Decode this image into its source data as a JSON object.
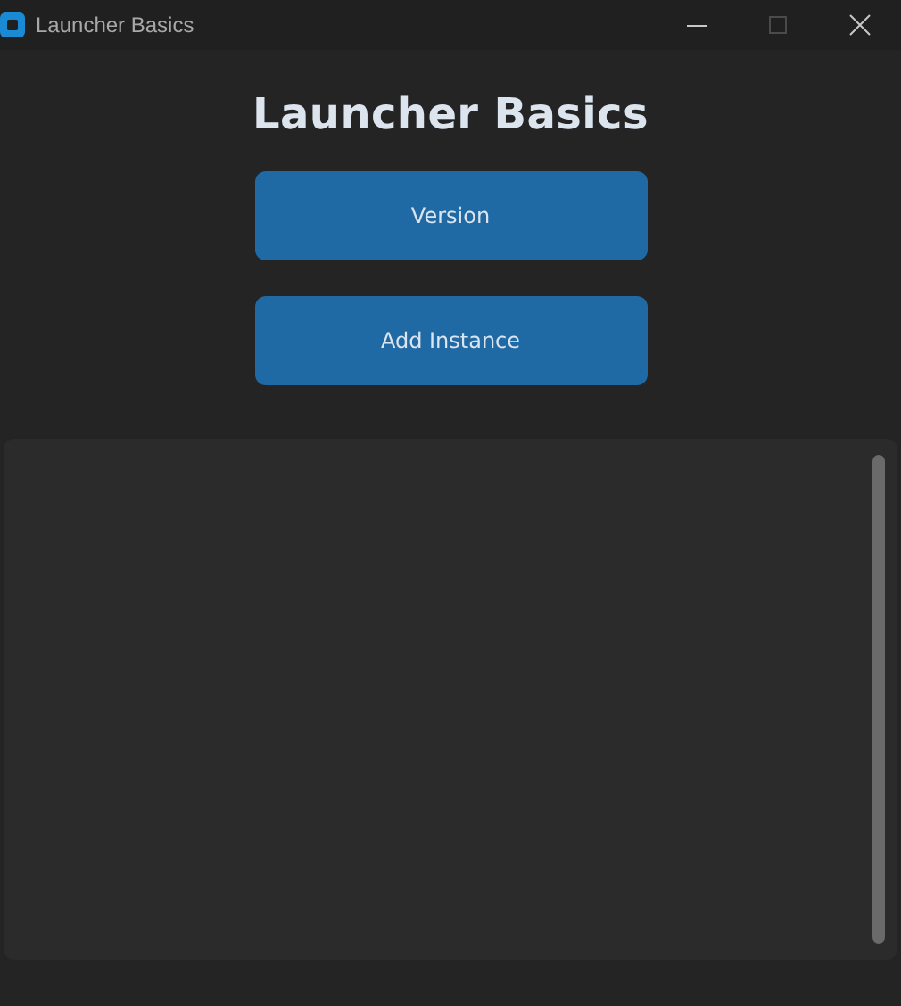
{
  "window": {
    "title": "Launcher Basics",
    "maximize_disabled": true
  },
  "heading": "Launcher Basics",
  "buttons": [
    "Version",
    "Add Instance"
  ],
  "output": {
    "scrollbar": true
  }
}
